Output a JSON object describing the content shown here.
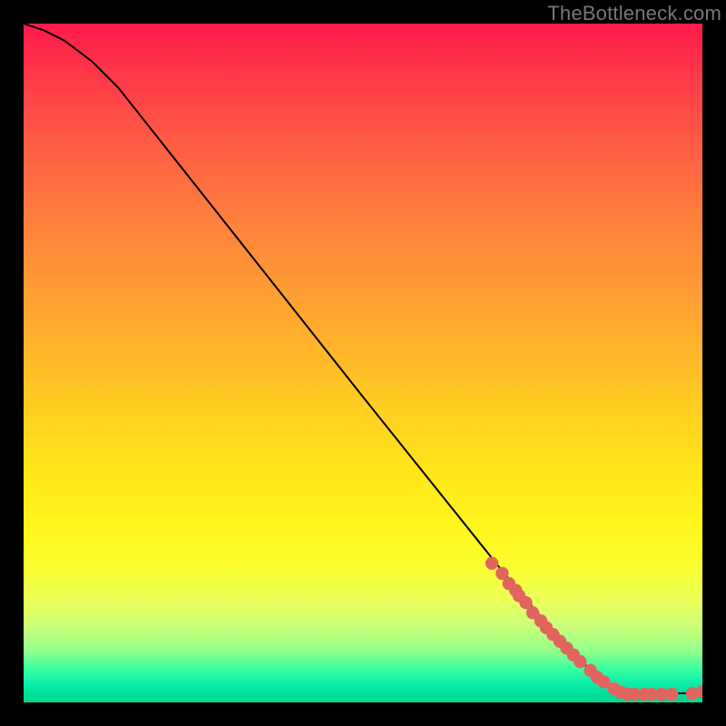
{
  "watermark": {
    "text": "TheBottleneck.com"
  },
  "colors": {
    "line": "#000000",
    "marker_fill": "#e2645f",
    "marker_stroke": "#c24846",
    "background": "#000000"
  },
  "chart_data": {
    "type": "line",
    "title": "",
    "xlabel": "",
    "ylabel": "",
    "xlim": [
      0,
      100
    ],
    "ylim": [
      0,
      100
    ],
    "grid": false,
    "legend": false,
    "series": [
      {
        "name": "curve",
        "x": [
          0,
          3,
          6,
          10,
          14,
          50,
          70,
          80,
          86,
          90,
          100
        ],
        "y": [
          100,
          99,
          97.5,
          94.5,
          90.5,
          45,
          20,
          8,
          2.5,
          1.2,
          1.4
        ]
      }
    ],
    "markers": [
      {
        "x": 69,
        "y": 20.5
      },
      {
        "x": 70.5,
        "y": 19
      },
      {
        "x": 71.5,
        "y": 17.5
      },
      {
        "x": 72.5,
        "y": 16.5
      },
      {
        "x": 73,
        "y": 15.7
      },
      {
        "x": 74,
        "y": 14.7
      },
      {
        "x": 75,
        "y": 13.2
      },
      {
        "x": 76.2,
        "y": 12
      },
      {
        "x": 77,
        "y": 11
      },
      {
        "x": 78,
        "y": 10
      },
      {
        "x": 79,
        "y": 9
      },
      {
        "x": 80,
        "y": 8
      },
      {
        "x": 81,
        "y": 7
      },
      {
        "x": 82,
        "y": 6
      },
      {
        "x": 83.5,
        "y": 4.7
      },
      {
        "x": 84.5,
        "y": 3.7
      },
      {
        "x": 85.5,
        "y": 3
      },
      {
        "x": 87,
        "y": 2
      },
      {
        "x": 88,
        "y": 1.5
      },
      {
        "x": 89,
        "y": 1.2
      },
      {
        "x": 90,
        "y": 1.2
      },
      {
        "x": 91.5,
        "y": 1.2
      },
      {
        "x": 92.5,
        "y": 1.2
      },
      {
        "x": 94,
        "y": 1.2
      },
      {
        "x": 95.5,
        "y": 1.2
      },
      {
        "x": 98.5,
        "y": 1.3
      },
      {
        "x": 100,
        "y": 1.6
      }
    ]
  }
}
